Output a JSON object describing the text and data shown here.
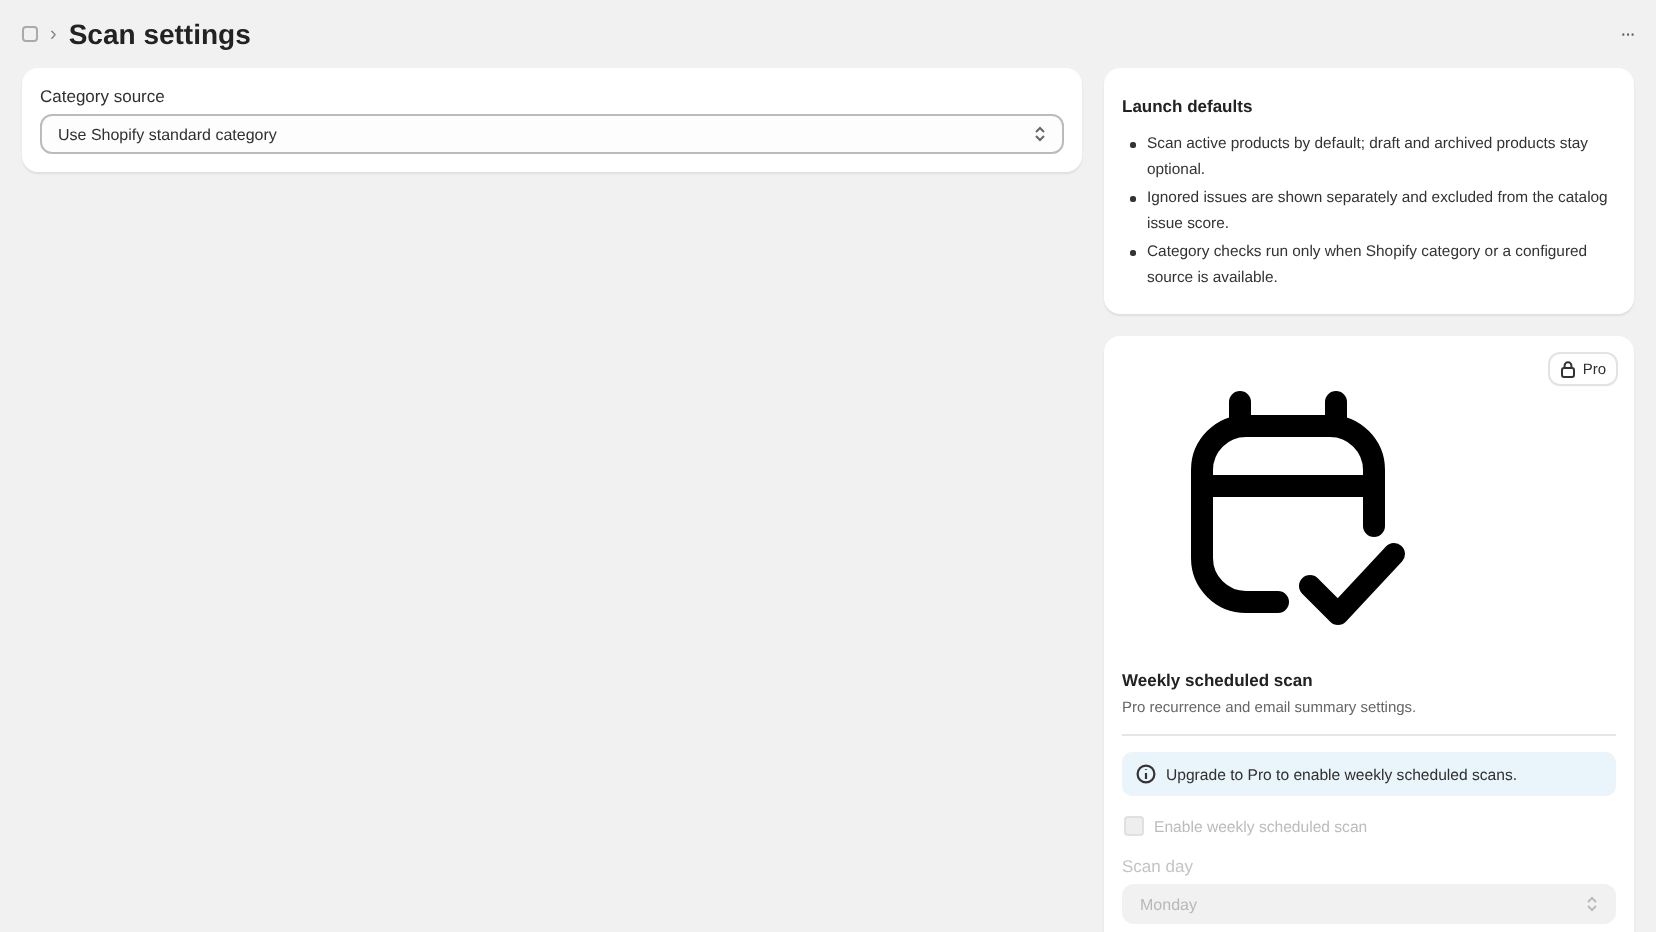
{
  "header": {
    "separator": "›",
    "title": "Scan settings",
    "more": "···"
  },
  "category_source": {
    "label": "Category source",
    "value": "Use Shopify standard category"
  },
  "launch_defaults": {
    "title": "Launch defaults",
    "items": [
      "Scan active products by default; draft and archived products stay optional.",
      "Ignored issues are shown separately and excluded from the catalog issue score.",
      "Category checks run only when Shopify category or a configured source is available."
    ]
  },
  "weekly": {
    "badge": "Pro",
    "title": "Weekly scheduled scan",
    "subtitle": "Pro recurrence and email summary settings.",
    "banner": "Upgrade to Pro to enable weekly scheduled scans.",
    "checkbox": {
      "label": "Enable weekly scheduled scan",
      "checked": false,
      "disabled": true
    },
    "day": {
      "label": "Scan day",
      "value": "Monday",
      "disabled": true
    }
  }
}
